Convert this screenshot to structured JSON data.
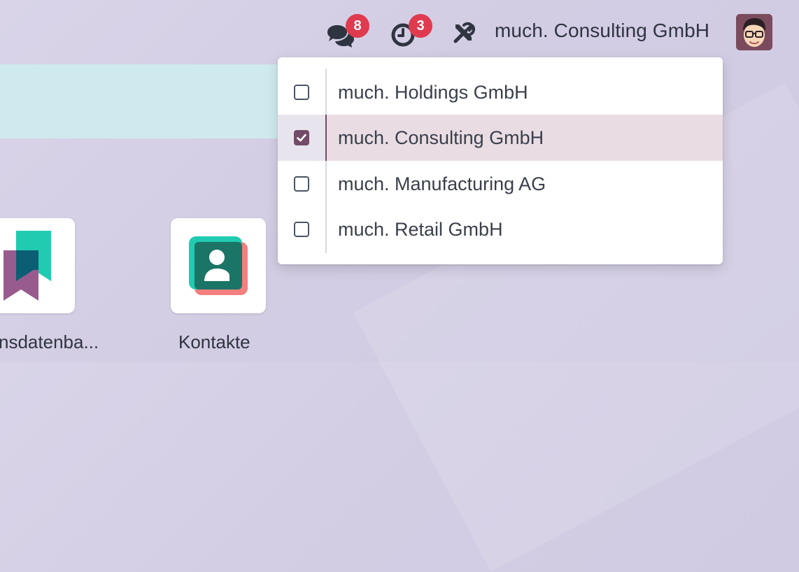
{
  "topbar": {
    "messages_badge": "8",
    "activities_badge": "3",
    "current_company": "much. Consulting GmbH"
  },
  "apps": [
    {
      "label": "nsdatenba..."
    },
    {
      "label": "Kontakte"
    }
  ],
  "company_dropdown": {
    "items": [
      {
        "label": "much. Holdings GmbH",
        "checked": false
      },
      {
        "label": "much. Consulting GmbH",
        "checked": true
      },
      {
        "label": "much. Manufacturing AG",
        "checked": false
      },
      {
        "label": "much. Retail GmbH",
        "checked": false
      }
    ]
  },
  "colors": {
    "accent": "#714b67",
    "badge": "#e03a4f",
    "banner": "#cfeaee",
    "selected_row": "#e9dde3"
  },
  "icons": {
    "messages": "chat-bubbles-icon",
    "activities": "clock-icon",
    "settings": "tools-icon",
    "user": "user-avatar"
  }
}
